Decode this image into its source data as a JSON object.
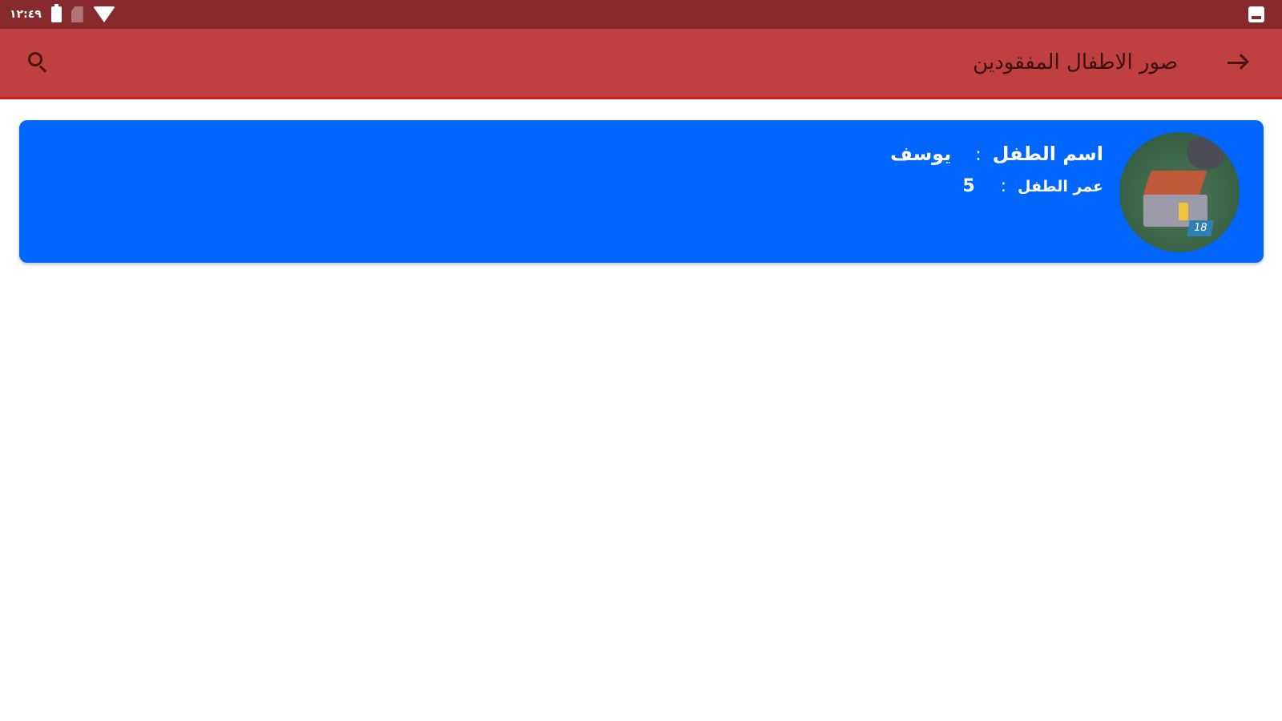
{
  "status_bar": {
    "time": "١٢:٤٩",
    "icons": [
      "battery-icon",
      "sim-icon",
      "wifi-icon",
      "notification-icon"
    ]
  },
  "app_bar": {
    "title": "صور الاطفال المفقودين",
    "back_icon": "arrow-forward-icon",
    "search_icon": "search-icon",
    "background": "#c04040"
  },
  "children": [
    {
      "name_label": "اسم الطفل",
      "name_separator": ":",
      "name": "يوسف",
      "age_label": "عمر الطفل",
      "age_separator": ":",
      "age": "5",
      "avatar_badge": "18",
      "card_color": "#0066fe"
    }
  ]
}
